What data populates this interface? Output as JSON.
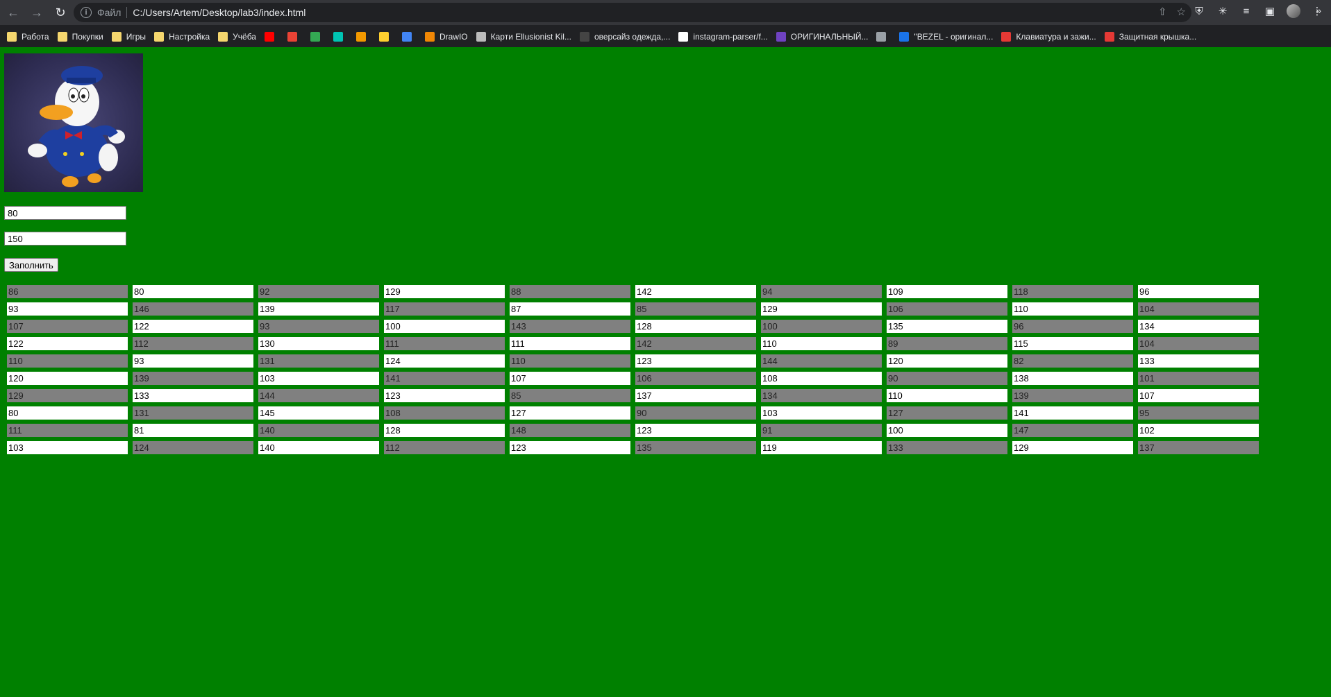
{
  "browser": {
    "scheme_label": "Файл",
    "url": "C:/Users/Artem/Desktop/lab3/index.html",
    "bookmarks": [
      {
        "label": "Работа",
        "icon": "folder-icon",
        "color": "#f5d76e"
      },
      {
        "label": "Покупки",
        "icon": "folder-icon",
        "color": "#f5d76e"
      },
      {
        "label": "Игры",
        "icon": "folder-icon",
        "color": "#f5d76e"
      },
      {
        "label": "Настройка",
        "icon": "folder-icon",
        "color": "#f5d76e"
      },
      {
        "label": "Учёба",
        "icon": "folder-icon",
        "color": "#f5d76e"
      },
      {
        "label": "",
        "icon": "youtube-icon",
        "color": "#ff0000"
      },
      {
        "label": "",
        "icon": "gmail-icon",
        "color": "#ea4335"
      },
      {
        "label": "",
        "icon": "pinwheel-icon",
        "color": "#34a853"
      },
      {
        "label": "",
        "icon": "oh-icon",
        "color": "#00c4b3"
      },
      {
        "label": "",
        "icon": "diamond-icon",
        "color": "#f29900"
      },
      {
        "label": "",
        "icon": "miro-icon",
        "color": "#ffd02f"
      },
      {
        "label": "",
        "icon": "shield-bm-icon",
        "color": "#4285f4"
      },
      {
        "label": "DrawIO",
        "icon": "drawio-icon",
        "color": "#f08705"
      },
      {
        "label": "Карти Ellusionist Kil...",
        "icon": "cards-icon",
        "color": "#bbbbbb"
      },
      {
        "label": "оверсайз одежда,...",
        "icon": "tag-icon",
        "color": "#444444"
      },
      {
        "label": "instagram-parser/f...",
        "icon": "github-icon",
        "color": "#ffffff"
      },
      {
        "label": "ОРИГИНАЛЬНЫЙ...",
        "icon": "square-bm-icon",
        "color": "#6f42c1"
      },
      {
        "label": "",
        "icon": "globe-icon",
        "color": "#9aa0a6"
      },
      {
        "label": "\"BEZEL - оригинал...",
        "icon": "bezel-icon",
        "color": "#1a73e8"
      },
      {
        "label": "Клавиатура и зажи...",
        "icon": "shop-icon",
        "color": "#e53935"
      },
      {
        "label": "Защитная крышка...",
        "icon": "plus-badge-icon",
        "color": "#e53935"
      }
    ]
  },
  "page": {
    "background": "#008000",
    "min_value": "80",
    "max_value": "150",
    "fill_button_label": "Заполнить",
    "table": [
      [
        "86",
        "80",
        "92",
        "129",
        "88",
        "142",
        "94",
        "109",
        "118",
        "96"
      ],
      [
        "93",
        "146",
        "139",
        "117",
        "87",
        "85",
        "129",
        "106",
        "110",
        "104"
      ],
      [
        "107",
        "122",
        "93",
        "100",
        "143",
        "128",
        "100",
        "135",
        "96",
        "134"
      ],
      [
        "122",
        "112",
        "130",
        "111",
        "111",
        "142",
        "110",
        "89",
        "115",
        "104"
      ],
      [
        "110",
        "93",
        "131",
        "124",
        "110",
        "123",
        "144",
        "120",
        "82",
        "133"
      ],
      [
        "120",
        "139",
        "103",
        "141",
        "107",
        "106",
        "108",
        "90",
        "138",
        "101"
      ],
      [
        "129",
        "133",
        "144",
        "123",
        "85",
        "137",
        "134",
        "110",
        "139",
        "107"
      ],
      [
        "80",
        "131",
        "145",
        "108",
        "127",
        "90",
        "103",
        "127",
        "141",
        "95"
      ],
      [
        "111",
        "81",
        "140",
        "128",
        "148",
        "123",
        "91",
        "100",
        "147",
        "102"
      ],
      [
        "103",
        "124",
        "140",
        "112",
        "123",
        "135",
        "119",
        "133",
        "129",
        "137"
      ]
    ]
  }
}
